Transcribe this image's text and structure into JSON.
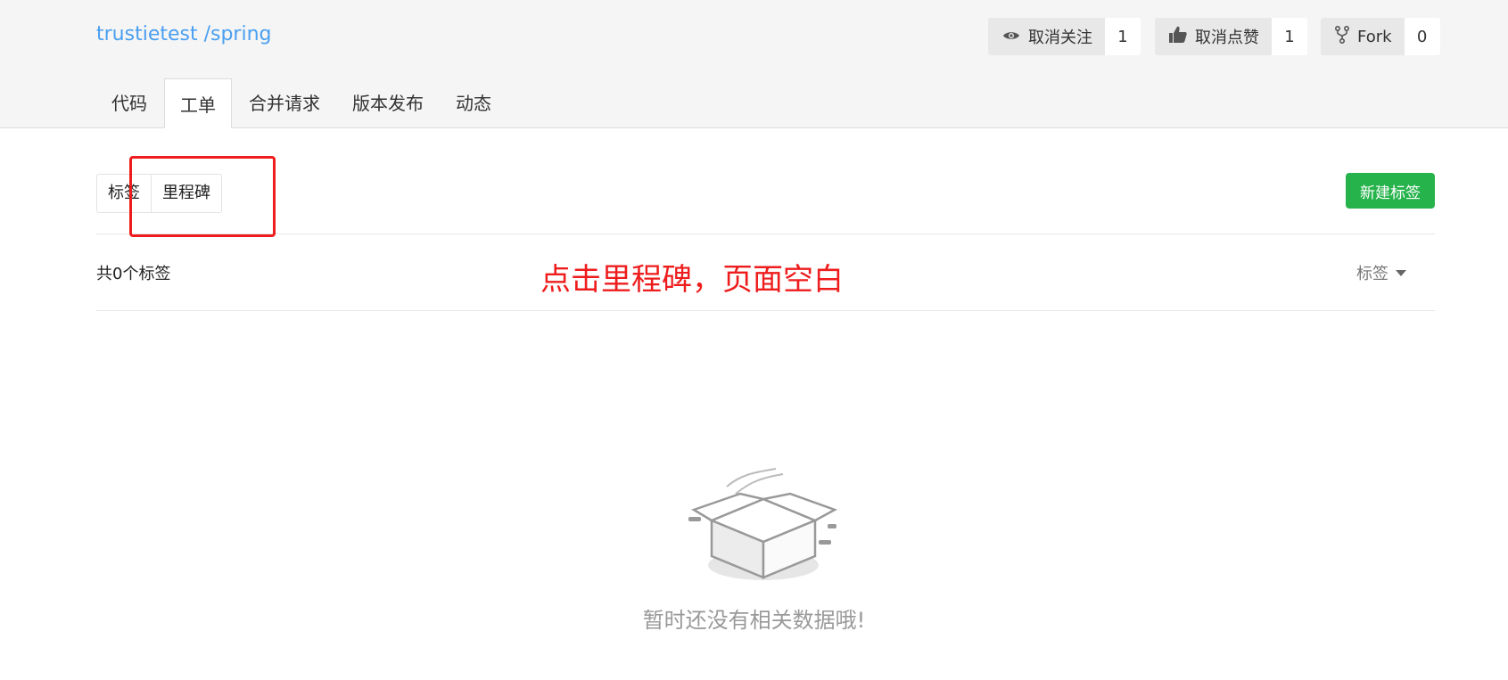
{
  "header": {
    "repo_title": "trustietest /spring",
    "stats": [
      {
        "label": "取消关注",
        "count": "1",
        "icon": "eye-icon"
      },
      {
        "label": "取消点赞",
        "count": "1",
        "icon": "thumbs-up-icon"
      },
      {
        "label": "Fork",
        "count": "0",
        "icon": "fork-icon"
      }
    ],
    "tabs": [
      "代码",
      "工单",
      "合并请求",
      "版本发布",
      "动态"
    ],
    "active_tab": "工单"
  },
  "subnav": {
    "items": [
      "标签",
      "里程碑"
    ],
    "new_button": "新建标签"
  },
  "list": {
    "total": "共0个标签",
    "filter_label": "标签"
  },
  "annotation": "点击里程碑，页面空白",
  "empty": {
    "message": "暂时还没有相关数据哦!",
    "icon": "empty-box-icon"
  },
  "colors": {
    "link": "#4a9ff0",
    "primary_button": "#27b34c",
    "annotation": "#ee1c1c"
  }
}
